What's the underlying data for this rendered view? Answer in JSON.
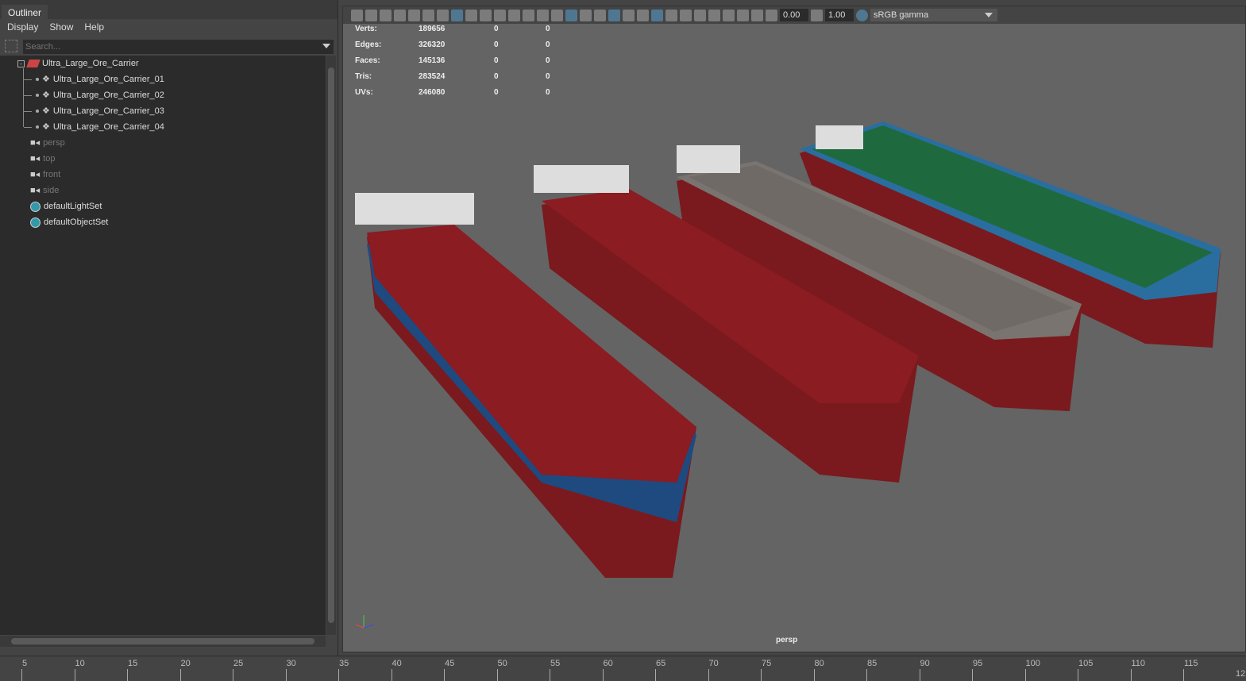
{
  "outliner": {
    "tab": "Outliner",
    "menu": [
      "Display",
      "Show",
      "Help"
    ],
    "search_placeholder": "Search...",
    "root": "Ultra_Large_Ore_Carrier",
    "children": [
      "Ultra_Large_Ore_Carrier_01",
      "Ultra_Large_Ore_Carrier_02",
      "Ultra_Large_Ore_Carrier_03",
      "Ultra_Large_Ore_Carrier_04"
    ],
    "cameras": [
      "persp",
      "top",
      "front",
      "side"
    ],
    "sets": [
      "defaultLightSet",
      "defaultObjectSet"
    ]
  },
  "toolbar": {
    "exposure": "0.00",
    "gamma": "1.00",
    "color_space": "sRGB gamma"
  },
  "stats": [
    [
      "Verts:",
      "189656",
      "0",
      "0"
    ],
    [
      "Edges:",
      "326320",
      "0",
      "0"
    ],
    [
      "Faces:",
      "145136",
      "0",
      "0"
    ],
    [
      "Tris:",
      "283524",
      "0",
      "0"
    ],
    [
      "UVs:",
      "246080",
      "0",
      "0"
    ]
  ],
  "viewport": {
    "camera": "persp"
  },
  "ships": [
    {
      "deck": "#8a1c22",
      "hull": "#1e4a80"
    },
    {
      "deck": "#8a1c22",
      "hull": "#8a1c22"
    },
    {
      "deck": "#6f6a66",
      "hull": "#7a7470"
    },
    {
      "deck": "#1e6a3e",
      "hull": "#2a6ea0"
    }
  ],
  "timeline": {
    "ticks": [
      "5",
      "10",
      "15",
      "20",
      "25",
      "30",
      "35",
      "40",
      "45",
      "50",
      "55",
      "60",
      "65",
      "70",
      "75",
      "80",
      "85",
      "90",
      "95",
      "100",
      "105",
      "110",
      "115"
    ],
    "end": "12"
  }
}
